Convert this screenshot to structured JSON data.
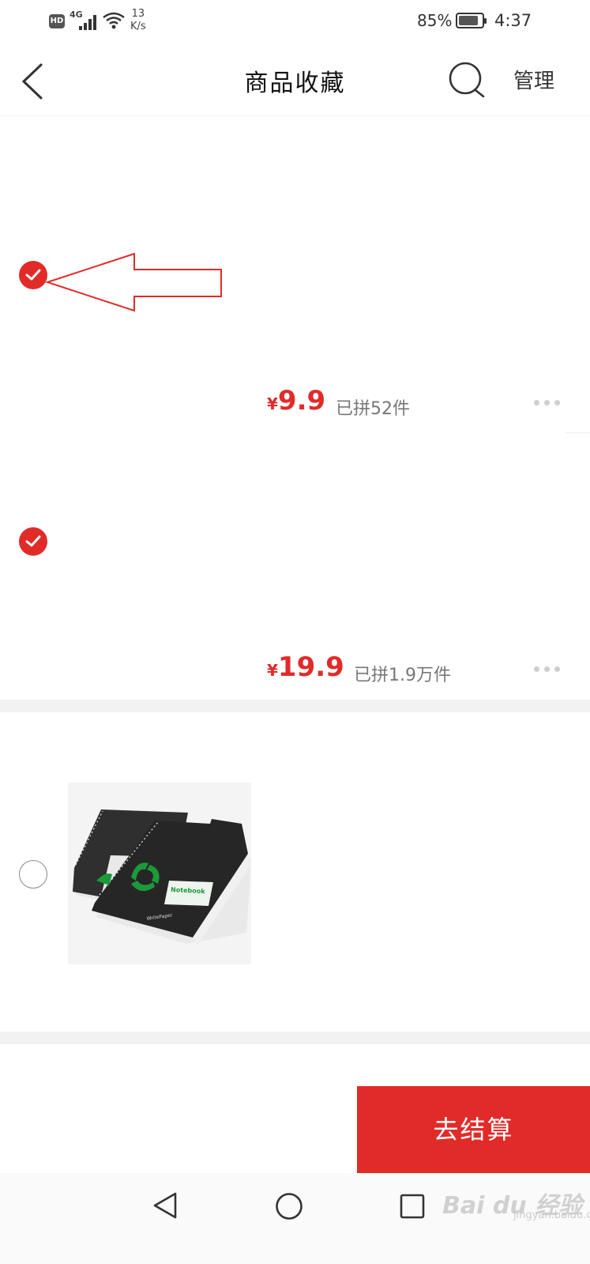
{
  "status_bar": {
    "hd": "HD",
    "network": "4G",
    "speed_value": "13",
    "speed_unit": "K/s",
    "battery": "85%",
    "time": "4:37"
  },
  "header": {
    "title": "商品收藏",
    "manage": "管理"
  },
  "items": [
    {
      "checked": true,
      "currency": "¥",
      "price": "9.9",
      "sold": "已拼52件"
    },
    {
      "checked": true,
      "currency": "¥",
      "price": "19.9",
      "sold": "已拼1.9万件"
    },
    {
      "checked": false,
      "image": "notebook"
    }
  ],
  "checkout": {
    "label": "去结算"
  },
  "colors": {
    "accent": "#e12b29"
  },
  "watermark": {
    "brand": "Bai du 经验",
    "url": "jingyan.baidu.com"
  }
}
